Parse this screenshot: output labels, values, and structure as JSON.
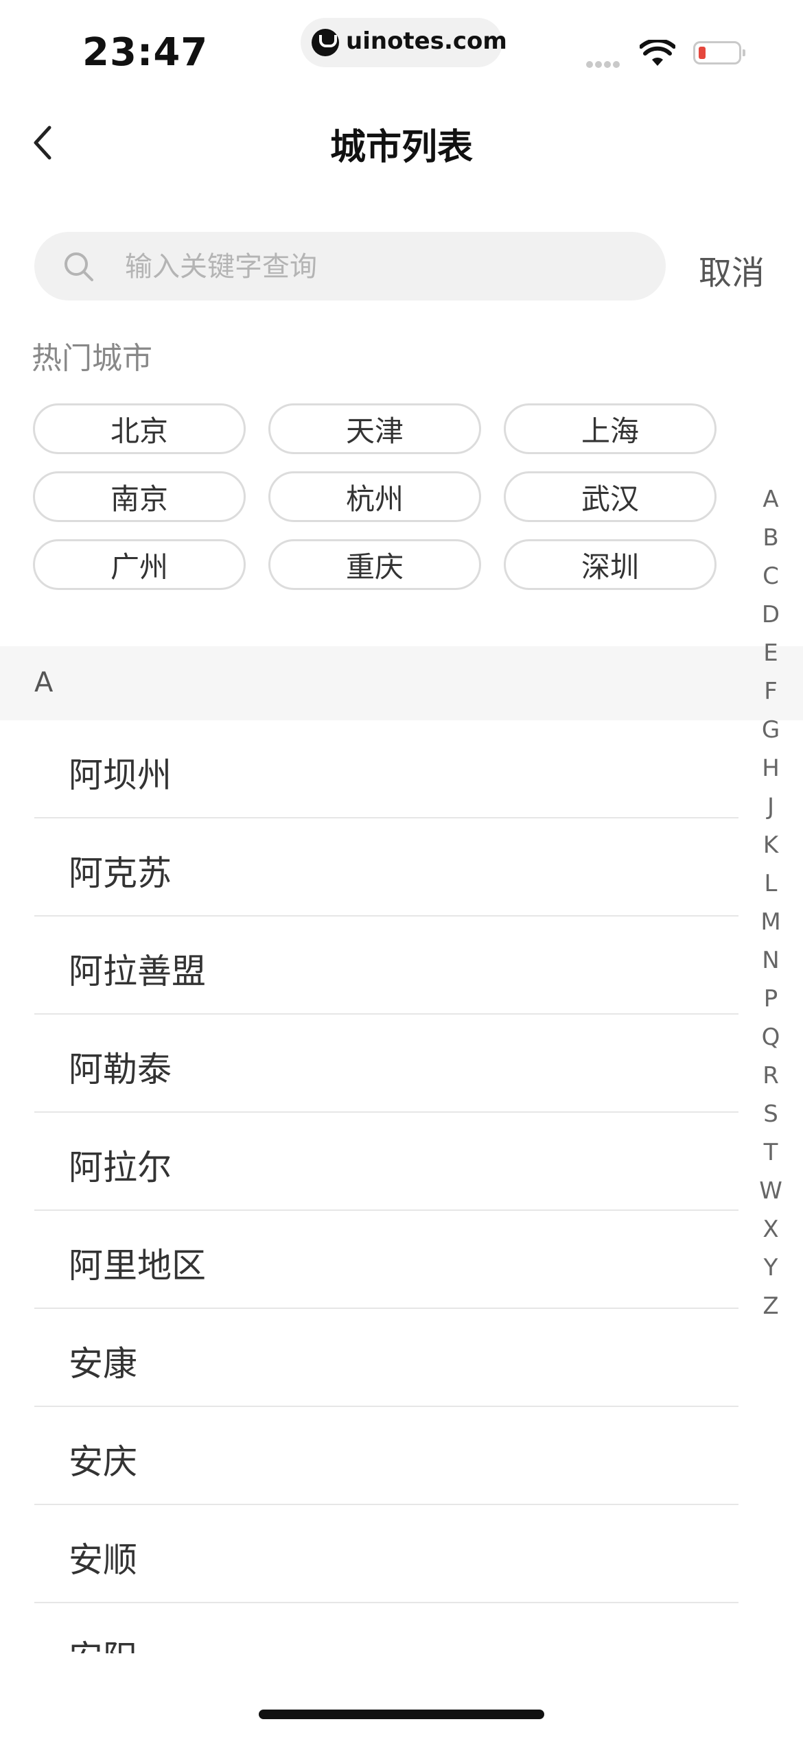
{
  "status_bar": {
    "time": "23:47",
    "url": "uinotes.com"
  },
  "nav": {
    "title": "城市列表"
  },
  "search": {
    "placeholder": "输入关键字查询",
    "cancel_label": "取消"
  },
  "hot": {
    "label": "热门城市",
    "cities": [
      "北京",
      "天津",
      "上海",
      "南京",
      "杭州",
      "武汉",
      "广州",
      "重庆",
      "深圳"
    ]
  },
  "section": {
    "letter": "A"
  },
  "cities": [
    "阿坝州",
    "阿克苏",
    "阿拉善盟",
    "阿勒泰",
    "阿拉尔",
    "阿里地区",
    "安康",
    "安庆",
    "安顺",
    "安阳"
  ],
  "index_letters": [
    "A",
    "B",
    "C",
    "D",
    "E",
    "F",
    "G",
    "H",
    "J",
    "K",
    "L",
    "M",
    "N",
    "P",
    "Q",
    "R",
    "S",
    "T",
    "W",
    "X",
    "Y",
    "Z"
  ]
}
